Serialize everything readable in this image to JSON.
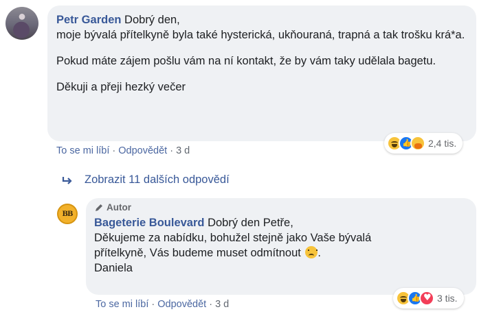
{
  "comment": {
    "author": "Petr Garden",
    "lines": [
      {
        "first": "Dobrý den,",
        "rest": "moje bývalá přítelkyně byla také hysterická, ukňouraná, trapná a tak trošku krá*a."
      },
      {
        "text": "Pokud máte zájem pošlu vám na ní kontakt, že by vám taky udělala bagetu."
      },
      {
        "text": "Děkuji a přeji hezký večer"
      }
    ],
    "actions": {
      "like": "To se mi líbí",
      "reply": "Odpovědět",
      "time": "3 d"
    },
    "reactions": {
      "icons": [
        "haha-icon",
        "like-icon",
        "care-icon"
      ],
      "count": "2,4 tis."
    }
  },
  "more_replies": {
    "label": "Zobrazit 11 dalších odpovědí"
  },
  "reply": {
    "badge": "Autor",
    "author": "Bageterie Boulevard",
    "greeting": "Dobrý den Petře,",
    "line2": "Děkujeme za nabídku, bohužel stejně jako Vaše bývalá",
    "line3": "přítelkyně, Vás budeme muset odmítnout",
    "line3_end": ".",
    "signature": "Daniela",
    "avatar_text": "BB",
    "actions": {
      "like": "To se mi líbí",
      "reply": "Odpovědět",
      "time": "3 d"
    },
    "reactions": {
      "icons": [
        "haha-icon",
        "like-icon",
        "love-icon"
      ],
      "count": "3 tis."
    }
  },
  "colors": {
    "link": "#385898",
    "bubble": "#eff1f4",
    "meta": "#65676b"
  }
}
